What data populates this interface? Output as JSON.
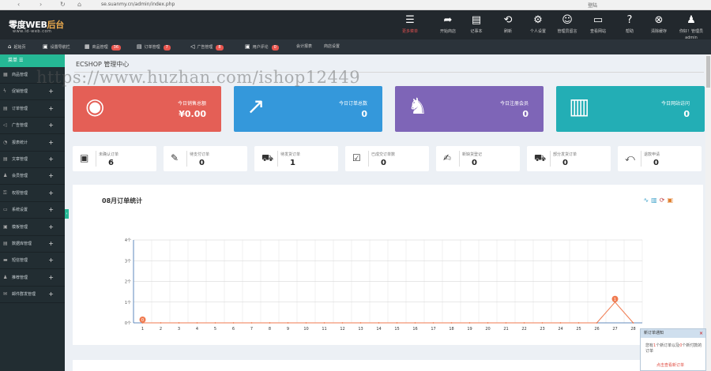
{
  "browser": {
    "nav": [
      "⊂",
      "⊃",
      "↻",
      "⌂"
    ],
    "url": "se.suanmy.cn/admin/index.php",
    "tab_text": "登陆"
  },
  "header": {
    "logo_main": "零度WEB",
    "logo_accent": "后台",
    "logo_sub": "www.ld-web.com",
    "buttons": [
      {
        "label": "更多菜单",
        "icon": "menu-icon",
        "glyph": "☰"
      },
      {
        "label": "开始商店",
        "icon": "share-icon",
        "glyph": "➦"
      },
      {
        "label": "记事本",
        "icon": "notepad-icon",
        "glyph": "▤"
      },
      {
        "label": "刷新",
        "icon": "refresh-icon",
        "glyph": "⟲"
      },
      {
        "label": "个人设置",
        "icon": "gear-icon",
        "glyph": "⚙"
      },
      {
        "label": "管理员留言",
        "icon": "message-icon",
        "glyph": "☺"
      },
      {
        "label": "查看网站",
        "icon": "monitor-icon",
        "glyph": "▭"
      },
      {
        "label": "帮助",
        "icon": "help-icon",
        "glyph": "?"
      },
      {
        "label": "清除缓存",
        "icon": "clear-cache-icon",
        "glyph": "⊗"
      },
      {
        "label": "你好！管理员",
        "label2": "admin",
        "icon": "user-icon",
        "glyph": "♟"
      }
    ]
  },
  "subnav": [
    {
      "label": "起始页",
      "icon": "home-icon",
      "glyph": "⌂",
      "badge": ""
    },
    {
      "label": "设置导航栏",
      "icon": "settings-nav-icon",
      "glyph": "▣",
      "badge": ""
    },
    {
      "label": "商品管理",
      "icon": "goods-icon",
      "glyph": "▦",
      "badge": "36"
    },
    {
      "label": "订单管理",
      "icon": "order-icon",
      "glyph": "▤",
      "badge": "7"
    },
    {
      "label": "广告管理",
      "icon": "ad-icon",
      "glyph": "◁",
      "badge": "8"
    },
    {
      "label": "用户评论",
      "icon": "comment-icon",
      "glyph": "▣",
      "badge": "0"
    },
    {
      "label": "会计报表",
      "icon": "",
      "glyph": "",
      "badge": ""
    },
    {
      "label": "商店设置",
      "icon": "",
      "glyph": "",
      "badge": ""
    }
  ],
  "sidebar": {
    "menu_label": "菜单",
    "items": [
      {
        "label": "商品管理",
        "icon": "goods-icon",
        "glyph": "▦",
        "plus": false
      },
      {
        "label": "促销管理",
        "icon": "promo-icon",
        "glyph": "ϟ",
        "plus": true
      },
      {
        "label": "订单管理",
        "icon": "order-icon",
        "glyph": "▤",
        "plus": true
      },
      {
        "label": "广告管理",
        "icon": "ad-icon",
        "glyph": "◁",
        "plus": true
      },
      {
        "label": "报表统计",
        "icon": "stats-icon",
        "glyph": "◔",
        "plus": true
      },
      {
        "label": "文章管理",
        "icon": "article-icon",
        "glyph": "▤",
        "plus": true
      },
      {
        "label": "会员管理",
        "icon": "member-icon",
        "glyph": "♟",
        "plus": true
      },
      {
        "label": "权限管理",
        "icon": "permission-icon",
        "glyph": "⚿",
        "plus": true
      },
      {
        "label": "系统设置",
        "icon": "system-icon",
        "glyph": "▭",
        "plus": true
      },
      {
        "label": "模板管理",
        "icon": "template-icon",
        "glyph": "▣",
        "plus": true
      },
      {
        "label": "数据库管理",
        "icon": "database-icon",
        "glyph": "▤",
        "plus": true
      },
      {
        "label": "短信管理",
        "icon": "sms-icon",
        "glyph": "▬",
        "plus": true
      },
      {
        "label": "推荐管理",
        "icon": "recommend-icon",
        "glyph": "♟",
        "plus": true
      },
      {
        "label": "邮件群发管理",
        "icon": "mail-icon",
        "glyph": "✉",
        "plus": true
      }
    ]
  },
  "main": {
    "title": "ECSHOP 管理中心",
    "watermark": "https://www.huzhan.com/ishop12449",
    "stats": [
      {
        "label": "今日销售总额",
        "value": "¥0.00",
        "color": "#e45f56",
        "icon": "coins-icon",
        "glyph": "◉"
      },
      {
        "label": "今日订单总数",
        "value": "0",
        "color": "#3498db",
        "icon": "trend-up-icon",
        "glyph": "↗"
      },
      {
        "label": "今日注册会员",
        "value": "0",
        "color": "#7e65b7",
        "icon": "users-icon",
        "glyph": "♞"
      },
      {
        "label": "今日网站访问",
        "value": "0",
        "color": "#23aeb5",
        "icon": "bar-chart-icon",
        "glyph": "▥"
      }
    ],
    "mini": [
      {
        "label": "未确认订单",
        "value": "6",
        "icon": "box-icon",
        "glyph": "▣"
      },
      {
        "label": "待支付订单",
        "value": "0",
        "icon": "clipboard-icon",
        "glyph": "✎"
      },
      {
        "label": "待发货订单",
        "value": "1",
        "icon": "truck-icon",
        "glyph": "⛟"
      },
      {
        "label": "已成交订单数",
        "value": "0",
        "icon": "checklist-icon",
        "glyph": "☑"
      },
      {
        "label": "新缺货登记",
        "value": "0",
        "icon": "edit-icon",
        "glyph": "✍"
      },
      {
        "label": "部分发货订单",
        "value": "0",
        "icon": "truck-icon",
        "glyph": "⛟"
      },
      {
        "label": "退款申请",
        "value": "0",
        "icon": "refund-icon",
        "glyph": "⤺"
      }
    ],
    "chart_title": "08月订单统计",
    "toolbox": [
      {
        "icon": "line-chart-icon",
        "glyph": "∿",
        "color": "#3aa0c8"
      },
      {
        "icon": "bar-chart-icon",
        "glyph": "▥",
        "color": "#3aa0c8"
      },
      {
        "icon": "restore-icon",
        "glyph": "⟳",
        "color": "#c04040"
      },
      {
        "icon": "save-image-icon",
        "glyph": "▣",
        "color": "#e08030"
      }
    ]
  },
  "chart_data": {
    "type": "line",
    "x": [
      "1",
      "2",
      "3",
      "4",
      "5",
      "6",
      "7",
      "8",
      "9",
      "10",
      "11",
      "12",
      "13",
      "14",
      "15",
      "16",
      "17",
      "18",
      "19",
      "20",
      "21",
      "22",
      "23",
      "24",
      "25",
      "26",
      "27",
      "28"
    ],
    "values": [
      0,
      0,
      0,
      0,
      0,
      0,
      0,
      0,
      0,
      0,
      0,
      0,
      0,
      0,
      0,
      0,
      0,
      0,
      0,
      0,
      0,
      0,
      0,
      0,
      0,
      0,
      1,
      0
    ],
    "ylim": [
      0,
      4
    ],
    "yticks": [
      "0个",
      "1个",
      "2个",
      "3个",
      "4个"
    ],
    "grid": true,
    "line_color": "#f07a4f",
    "marked_points": [
      {
        "x": "1",
        "label": "0"
      },
      {
        "x": "27",
        "label": "1"
      }
    ]
  },
  "popup": {
    "title": "新订单通知",
    "close": "×",
    "body_prefix": "您有",
    "new_orders": "1",
    "body_middle": "个新订单以及",
    "paid_orders": "0",
    "body_suffix": "个新付款的订单",
    "link": "点击查看新订单"
  }
}
